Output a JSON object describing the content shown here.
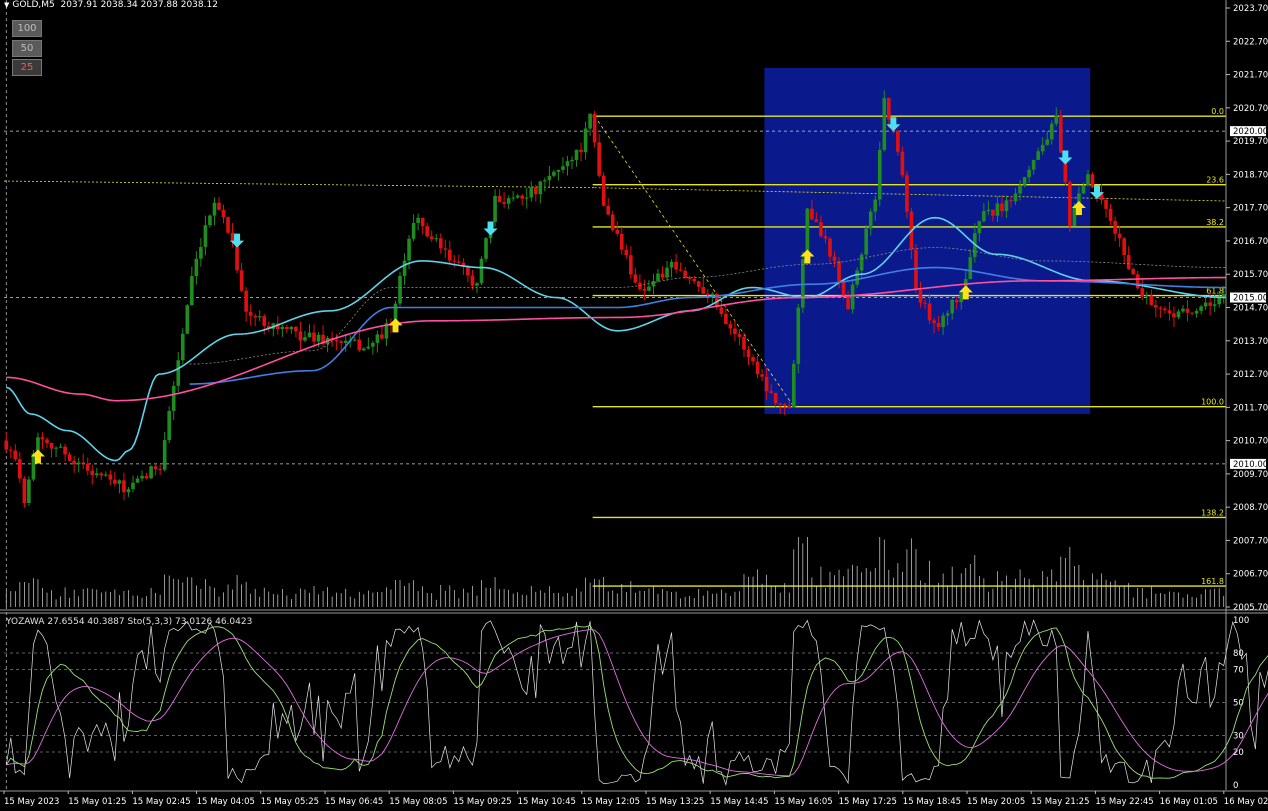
{
  "header": {
    "symbol": "GOLD,M5",
    "ohlc": "2037.91 2038.34 2037.88 2038.12"
  },
  "lot_buttons": [
    "100",
    "50",
    "25"
  ],
  "indicator_label": "YOZAWA 27.6554 40.3887  Sto(5,3,3) 73.0126 46.0423",
  "colors": {
    "background": "#000000",
    "bull": "#1f8c1f",
    "bear": "#e01010",
    "fib": "#e6e620",
    "highlight_box": "#0a1a8c",
    "ma_fast": "#5fd3ea",
    "ma_mid": "#3f7fe0",
    "ma_slow": "#ff4fa0",
    "arrow_up": "#ffe21a",
    "arrow_down": "#4fe0f0",
    "axis_text": "#ffffff"
  },
  "chart_data": [
    {
      "type": "candlestick",
      "symbol": "GOLD",
      "timeframe": "M5",
      "y_axis": {
        "range": [
          2005.7,
          2023.7
        ],
        "ticks": [
          "2023.70",
          "2022.70",
          "2021.70",
          "2020.70",
          "2019.70",
          "2018.70",
          "2017.70",
          "2016.70",
          "2015.70",
          "2014.70",
          "2013.70",
          "2012.70",
          "2011.70",
          "2010.70",
          "2009.70",
          "2008.70",
          "2007.70",
          "2006.70",
          "2005.70"
        ],
        "marked_levels": [
          "2020.00",
          "2015.00",
          "2010.00"
        ]
      },
      "x_axis": {
        "ticks": [
          "15 May 2023",
          "15 May 01:25",
          "15 May 02:45",
          "15 May 04:05",
          "15 May 05:25",
          "15 May 06:45",
          "15 May 08:05",
          "15 May 09:25",
          "15 May 10:45",
          "15 May 12:05",
          "15 May 13:25",
          "15 May 14:45",
          "15 May 16:05",
          "15 May 17:25",
          "15 May 18:45",
          "15 May 20:05",
          "15 May 21:25",
          "15 May 22:45",
          "16 May 01:05",
          "16 May 02"
        ]
      },
      "fibonacci": {
        "anchor_high": 2020.45,
        "anchor_low": 2011.72,
        "levels": [
          {
            "label": "0.0",
            "price": 2020.45
          },
          {
            "label": "23.6",
            "price": 2018.39
          },
          {
            "label": "38.2",
            "price": 2017.12
          },
          {
            "label": "61.8",
            "price": 2015.06
          },
          {
            "label": "100.0",
            "price": 2011.72
          },
          {
            "label": "138.2",
            "price": 2008.39
          },
          {
            "label": "161.8",
            "price": 2006.33
          }
        ]
      },
      "highlight_range": {
        "from": "15 May 14:00",
        "to": "15 May 19:55",
        "price_low": 2011.5,
        "price_high": 2021.9
      },
      "path_knots": [
        {
          "time": "15 May 00:00",
          "price": 2010.7
        },
        {
          "time": "15 May 00:10",
          "price": 2010.5
        },
        {
          "time": "15 May 00:25",
          "price": 2009.0
        },
        {
          "time": "15 May 00:40",
          "price": 2010.9
        },
        {
          "time": "15 May 01:25",
          "price": 2010.0
        },
        {
          "time": "15 May 02:20",
          "price": 2009.2
        },
        {
          "time": "15 May 02:55",
          "price": 2010.0
        },
        {
          "time": "15 May 03:30",
          "price": 2015.5
        },
        {
          "time": "15 May 03:55",
          "price": 2018.0
        },
        {
          "time": "15 May 04:15",
          "price": 2016.7
        },
        {
          "time": "15 May 04:30",
          "price": 2014.5
        },
        {
          "time": "15 May 05:25",
          "price": 2013.9
        },
        {
          "time": "15 May 06:45",
          "price": 2013.5
        },
        {
          "time": "15 May 07:10",
          "price": 2014.2
        },
        {
          "time": "15 May 07:35",
          "price": 2017.4
        },
        {
          "time": "15 May 08:10",
          "price": 2016.3
        },
        {
          "time": "15 May 08:45",
          "price": 2015.4
        },
        {
          "time": "15 May 09:05",
          "price": 2017.9
        },
        {
          "time": "15 May 09:50",
          "price": 2018.2
        },
        {
          "time": "15 May 10:40",
          "price": 2019.5
        },
        {
          "time": "15 May 10:50",
          "price": 2020.4
        },
        {
          "time": "15 May 11:05",
          "price": 2017.8
        },
        {
          "time": "15 May 11:45",
          "price": 2015.2
        },
        {
          "time": "15 May 12:20",
          "price": 2015.9
        },
        {
          "time": "15 May 13:00",
          "price": 2015.2
        },
        {
          "time": "15 May 13:40",
          "price": 2013.5
        },
        {
          "time": "15 May 14:10",
          "price": 2012.1
        },
        {
          "time": "15 May 14:30",
          "price": 2011.6
        },
        {
          "time": "15 May 14:50",
          "price": 2017.8
        },
        {
          "time": "15 May 15:15",
          "price": 2016.4
        },
        {
          "time": "15 May 15:35",
          "price": 2014.8
        },
        {
          "time": "15 May 16:05",
          "price": 2018.0
        },
        {
          "time": "15 May 16:15",
          "price": 2021.0
        },
        {
          "time": "15 May 16:35",
          "price": 2018.8
        },
        {
          "time": "15 May 16:50",
          "price": 2015.2
        },
        {
          "time": "15 May 17:10",
          "price": 2014.1
        },
        {
          "time": "15 May 17:40",
          "price": 2015.1
        },
        {
          "time": "15 May 18:00",
          "price": 2017.4
        },
        {
          "time": "15 May 18:30",
          "price": 2017.8
        },
        {
          "time": "15 May 19:05",
          "price": 2019.4
        },
        {
          "time": "15 May 19:25",
          "price": 2020.3
        },
        {
          "time": "15 May 19:40",
          "price": 2017.3
        },
        {
          "time": "15 May 20:00",
          "price": 2018.6
        },
        {
          "time": "15 May 20:30",
          "price": 2017.0
        },
        {
          "time": "15 May 20:55",
          "price": 2015.3
        },
        {
          "time": "15 May 21:20",
          "price": 2014.6
        },
        {
          "time": "15 May 22:00",
          "price": 2014.5
        },
        {
          "time": "15 May 22:40",
          "price": 2015.3
        },
        {
          "time": "15 May 23:30",
          "price": 2015.5
        },
        {
          "time": "16 May 00:20",
          "price": 2015.6
        },
        {
          "time": "16 May 01:00",
          "price": 2015.3
        },
        {
          "time": "16 May 01:15",
          "price": 2014.2
        },
        {
          "time": "16 May 01:30",
          "price": 2015.0
        }
      ],
      "moving_averages": [
        {
          "role": "fast",
          "color": "#5fd3ea",
          "points": [
            [
              0,
              2012.3
            ],
            [
              4,
              2011.5
            ],
            [
              10,
              2011.0
            ],
            [
              18,
              2010.1
            ],
            [
              20,
              2010.4
            ],
            [
              25,
              2012.7
            ],
            [
              38,
              2013.9
            ],
            [
              53,
              2014.6
            ],
            [
              68,
              2016.1
            ],
            [
              78,
              2015.9
            ],
            [
              90,
              2015.0
            ],
            [
              100,
              2014.0
            ],
            [
              112,
              2014.6
            ],
            [
              122,
              2015.3
            ],
            [
              131,
              2015.0
            ],
            [
              140,
              2015.7
            ],
            [
              152,
              2017.4
            ],
            [
              162,
              2016.3
            ],
            [
              178,
              2015.5
            ],
            [
              200,
              2015.0
            ]
          ]
        },
        {
          "role": "mid",
          "color": "#3f7fe0",
          "points": [
            [
              30,
              2012.4
            ],
            [
              50,
              2012.8
            ],
            [
              63,
              2014.7
            ],
            [
              85,
              2014.7
            ],
            [
              100,
              2014.7
            ],
            [
              112,
              2015.0
            ],
            [
              132,
              2015.4
            ],
            [
              152,
              2015.9
            ],
            [
              170,
              2015.5
            ],
            [
              200,
              2015.3
            ]
          ]
        },
        {
          "role": "slow",
          "color": "#ff4fa0",
          "points": [
            [
              0,
              2012.6
            ],
            [
              12,
              2012.1
            ],
            [
              18,
              2011.9
            ],
            [
              70,
              2014.3
            ],
            [
              100,
              2014.4
            ],
            [
              130,
              2015.0
            ],
            [
              168,
              2015.5
            ],
            [
              200,
              2015.6
            ]
          ]
        }
      ],
      "signals": [
        {
          "time": "15 May 00:35",
          "direction": "up"
        },
        {
          "time": "15 May 04:15",
          "direction": "down"
        },
        {
          "time": "15 May 07:10",
          "direction": "up"
        },
        {
          "time": "15 May 08:55",
          "direction": "down"
        },
        {
          "time": "15 May 14:45",
          "direction": "up"
        },
        {
          "time": "15 May 16:20",
          "direction": "down"
        },
        {
          "time": "15 May 17:40",
          "direction": "up"
        },
        {
          "time": "15 May 19:30",
          "direction": "down"
        },
        {
          "time": "15 May 19:45",
          "direction": "up"
        },
        {
          "time": "15 May 20:05",
          "direction": "down"
        }
      ]
    },
    {
      "type": "line",
      "name": "YOZAWA / Sto(5,3,3)",
      "y_axis": {
        "range": [
          0,
          100
        ],
        "ticks": [
          "100",
          "80",
          "70",
          "50",
          "30",
          "20",
          "0"
        ]
      },
      "values_now": {
        "yozawa": [
          27.6554,
          40.3887
        ],
        "stochastic": [
          73.0126,
          46.0423
        ]
      }
    }
  ]
}
